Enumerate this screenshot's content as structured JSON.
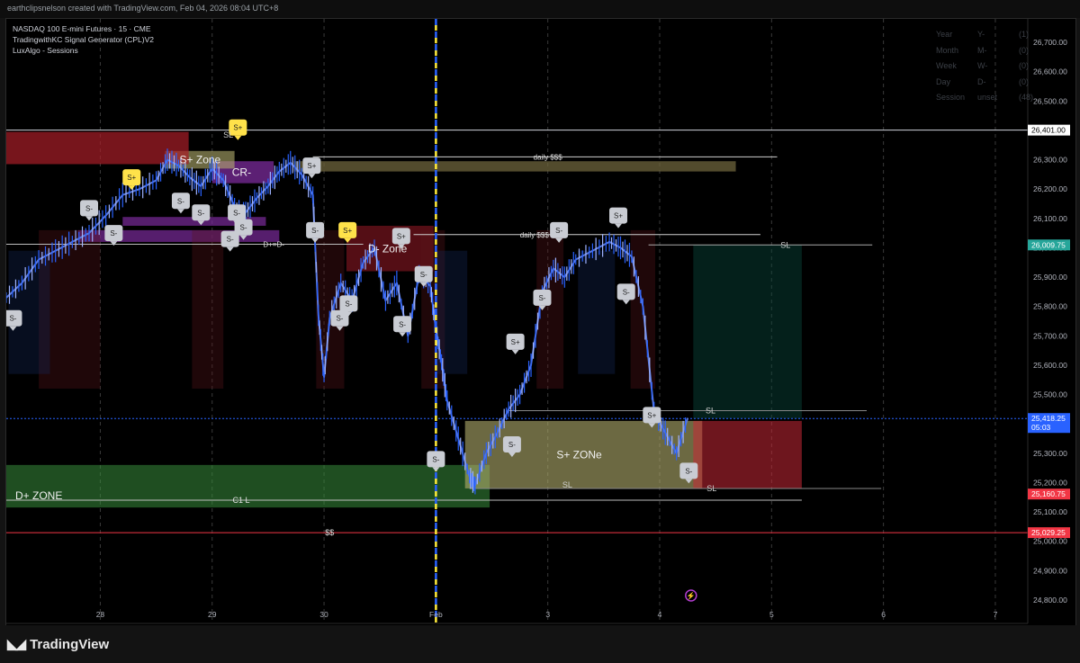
{
  "header": {
    "credit": "earthclipsnelson created with TradingView.com, Feb 04, 2026 08:04 UTC+8"
  },
  "indicators": [
    "NASDAQ 100 E-mini Futures · 15 · CME",
    "TradingwithKC Signal Generator (CPL)V2",
    "LuxAlgo - Sessions"
  ],
  "session_table": [
    {
      "label": "Year",
      "key": "Y-",
      "value": "(1)"
    },
    {
      "label": "Month",
      "key": "M-",
      "value": "(0)"
    },
    {
      "label": "Week",
      "key": "W-",
      "value": "(0)"
    },
    {
      "label": "Day",
      "key": "D-",
      "value": "(0)"
    },
    {
      "label": "Session",
      "key": "unset",
      "value": "(48)"
    }
  ],
  "footer": {
    "brand": "TradingView"
  },
  "colors": {
    "bg": "#000000",
    "candle": "#2962ff",
    "price_line_blue": "#2962ff",
    "red": "#f23645",
    "green_zone": "#1b5e20",
    "sand_zone": "#6b6b3a",
    "purple": "#7b2b9b",
    "yellow": "#ffeb3b"
  },
  "chart_data": {
    "type": "line",
    "title": "",
    "xlabel": "",
    "ylabel": "",
    "ylim": [
      24720,
      26780
    ],
    "y_ticks": [
      24800,
      24900,
      25000,
      25100,
      25200,
      25300,
      25400,
      25500,
      25600,
      25700,
      25800,
      25900,
      26000,
      26100,
      26200,
      26300,
      26400,
      26500,
      26600,
      26700
    ],
    "x_ticks": [
      {
        "i": 0,
        "label": "28"
      },
      {
        "i": 1,
        "label": "29"
      },
      {
        "i": 2,
        "label": "30"
      },
      {
        "i": 3,
        "label": "Feb"
      },
      {
        "i": 4,
        "label": "3"
      },
      {
        "i": 5,
        "label": "4"
      },
      {
        "i": 6,
        "label": "5"
      },
      {
        "i": 7,
        "label": "6"
      },
      {
        "i": 8,
        "label": "7"
      }
    ],
    "xlim": [
      -0.84,
      8.29
    ],
    "series": [
      {
        "values": [
          [
            -0.84,
            25830
          ],
          [
            -0.7,
            25880
          ],
          [
            -0.55,
            25960
          ],
          [
            -0.4,
            25990
          ],
          [
            -0.25,
            26020
          ],
          [
            -0.1,
            26050
          ],
          [
            0.05,
            26110
          ],
          [
            0.2,
            26180
          ],
          [
            0.35,
            26200
          ],
          [
            0.5,
            26230
          ],
          [
            0.6,
            26300
          ],
          [
            0.7,
            26280
          ],
          [
            0.8,
            26240
          ],
          [
            0.9,
            26210
          ],
          [
            1.0,
            26270
          ],
          [
            1.1,
            26230
          ],
          [
            1.2,
            26140
          ],
          [
            1.3,
            26120
          ],
          [
            1.4,
            26170
          ],
          [
            1.5,
            26210
          ],
          [
            1.6,
            26260
          ],
          [
            1.7,
            26290
          ],
          [
            1.8,
            26250
          ],
          [
            1.9,
            26180
          ],
          [
            1.95,
            25770
          ],
          [
            2.0,
            25560
          ],
          [
            2.05,
            25760
          ],
          [
            2.15,
            25880
          ],
          [
            2.25,
            25820
          ],
          [
            2.35,
            25950
          ],
          [
            2.45,
            26000
          ],
          [
            2.55,
            25820
          ],
          [
            2.65,
            25880
          ],
          [
            2.75,
            25700
          ],
          [
            2.85,
            25910
          ],
          [
            2.95,
            25870
          ],
          [
            3.0,
            25720
          ],
          [
            3.05,
            25610
          ],
          [
            3.1,
            25480
          ],
          [
            3.2,
            25350
          ],
          [
            3.3,
            25220
          ],
          [
            3.35,
            25190
          ],
          [
            3.45,
            25300
          ],
          [
            3.55,
            25370
          ],
          [
            3.65,
            25450
          ],
          [
            3.75,
            25500
          ],
          [
            3.85,
            25600
          ],
          [
            3.95,
            25850
          ],
          [
            4.05,
            25930
          ],
          [
            4.15,
            25900
          ],
          [
            4.25,
            25960
          ],
          [
            4.4,
            25990
          ],
          [
            4.55,
            26020
          ],
          [
            4.65,
            26000
          ],
          [
            4.75,
            25970
          ],
          [
            4.85,
            25800
          ],
          [
            4.95,
            25440
          ],
          [
            5.05,
            25370
          ],
          [
            5.15,
            25300
          ],
          [
            5.25,
            25420
          ]
        ]
      }
    ],
    "levels": [
      {
        "price": 26401.0,
        "label": "26,401.00",
        "kind": "white"
      },
      {
        "price": 26009.75,
        "label": "26,009.75",
        "kind": "green"
      },
      {
        "price": 25418.25,
        "label": "25,418.25",
        "sub": "05:03",
        "kind": "blue"
      },
      {
        "price": 25160.75,
        "label": "25,160.75",
        "kind": "red"
      },
      {
        "price": 25029.25,
        "label": "25,029.25",
        "kind": "red"
      }
    ],
    "zones": [
      {
        "label": "D+ ZONE",
        "x0": -0.84,
        "x1": 3.48,
        "y0": 25260,
        "y1": 25115,
        "kind": "green"
      },
      {
        "label": "S+ ZONe",
        "x0": 3.26,
        "x1": 5.38,
        "y0": 25410,
        "y1": 25180,
        "kind": "sand"
      },
      {
        "label": "D- Zone",
        "x0": 2.2,
        "x1": 2.98,
        "y0": 26075,
        "y1": 25920,
        "kind": "red"
      },
      {
        "label": "CR-",
        "x0": 1.0,
        "x1": 1.55,
        "y0": 26295,
        "y1": 26220,
        "kind": "purple"
      },
      {
        "label": "S+ Zone",
        "x0": 0.58,
        "x1": 1.2,
        "y0": 26330,
        "y1": 26270,
        "kind": "sand"
      }
    ],
    "texts": [
      "daily $$$",
      "daily $$$",
      "SL",
      "SL",
      "SL",
      "SL",
      "SL",
      "D+=D-",
      "C1 L",
      "$$"
    ],
    "markers": [
      {
        "x": 0.28,
        "y": 26240,
        "t": "S+"
      },
      {
        "x": -0.1,
        "y": 26135,
        "t": "S-"
      },
      {
        "x": 0.12,
        "y": 26050,
        "t": "S-"
      },
      {
        "x": 0.72,
        "y": 26160,
        "t": "S-"
      },
      {
        "x": 0.9,
        "y": 26120,
        "t": "S-"
      },
      {
        "x": 1.22,
        "y": 26120,
        "t": "S-"
      },
      {
        "x": 1.16,
        "y": 26030,
        "t": "S-"
      },
      {
        "x": 1.28,
        "y": 26070,
        "t": "S-"
      },
      {
        "x": 1.89,
        "y": 26280,
        "t": "S+"
      },
      {
        "x": 1.92,
        "y": 26060,
        "t": "S-"
      },
      {
        "x": 2.22,
        "y": 25810,
        "t": "S-"
      },
      {
        "x": 2.14,
        "y": 25760,
        "t": "S-"
      },
      {
        "x": 2.69,
        "y": 26040,
        "t": "S+"
      },
      {
        "x": 2.89,
        "y": 25910,
        "t": "S-"
      },
      {
        "x": 2.7,
        "y": 25740,
        "t": "S-"
      },
      {
        "x": 3.0,
        "y": 25280,
        "t": "S-"
      },
      {
        "x": 3.68,
        "y": 25330,
        "t": "S-"
      },
      {
        "x": 3.71,
        "y": 25680,
        "t": "S+"
      },
      {
        "x": 3.95,
        "y": 25830,
        "t": "S-"
      },
      {
        "x": 4.1,
        "y": 26060,
        "t": "S-"
      },
      {
        "x": 4.63,
        "y": 26110,
        "t": "S+"
      },
      {
        "x": 4.7,
        "y": 25850,
        "t": "S-"
      },
      {
        "x": 4.93,
        "y": 25430,
        "t": "S+"
      },
      {
        "x": 5.26,
        "y": 25240,
        "t": "S-"
      },
      {
        "x": -0.78,
        "y": 25760,
        "t": "S-"
      },
      {
        "x": 1.23,
        "y": 26410,
        "t": "S+"
      },
      {
        "x": 2.21,
        "y": 26060,
        "t": "S+"
      }
    ]
  }
}
